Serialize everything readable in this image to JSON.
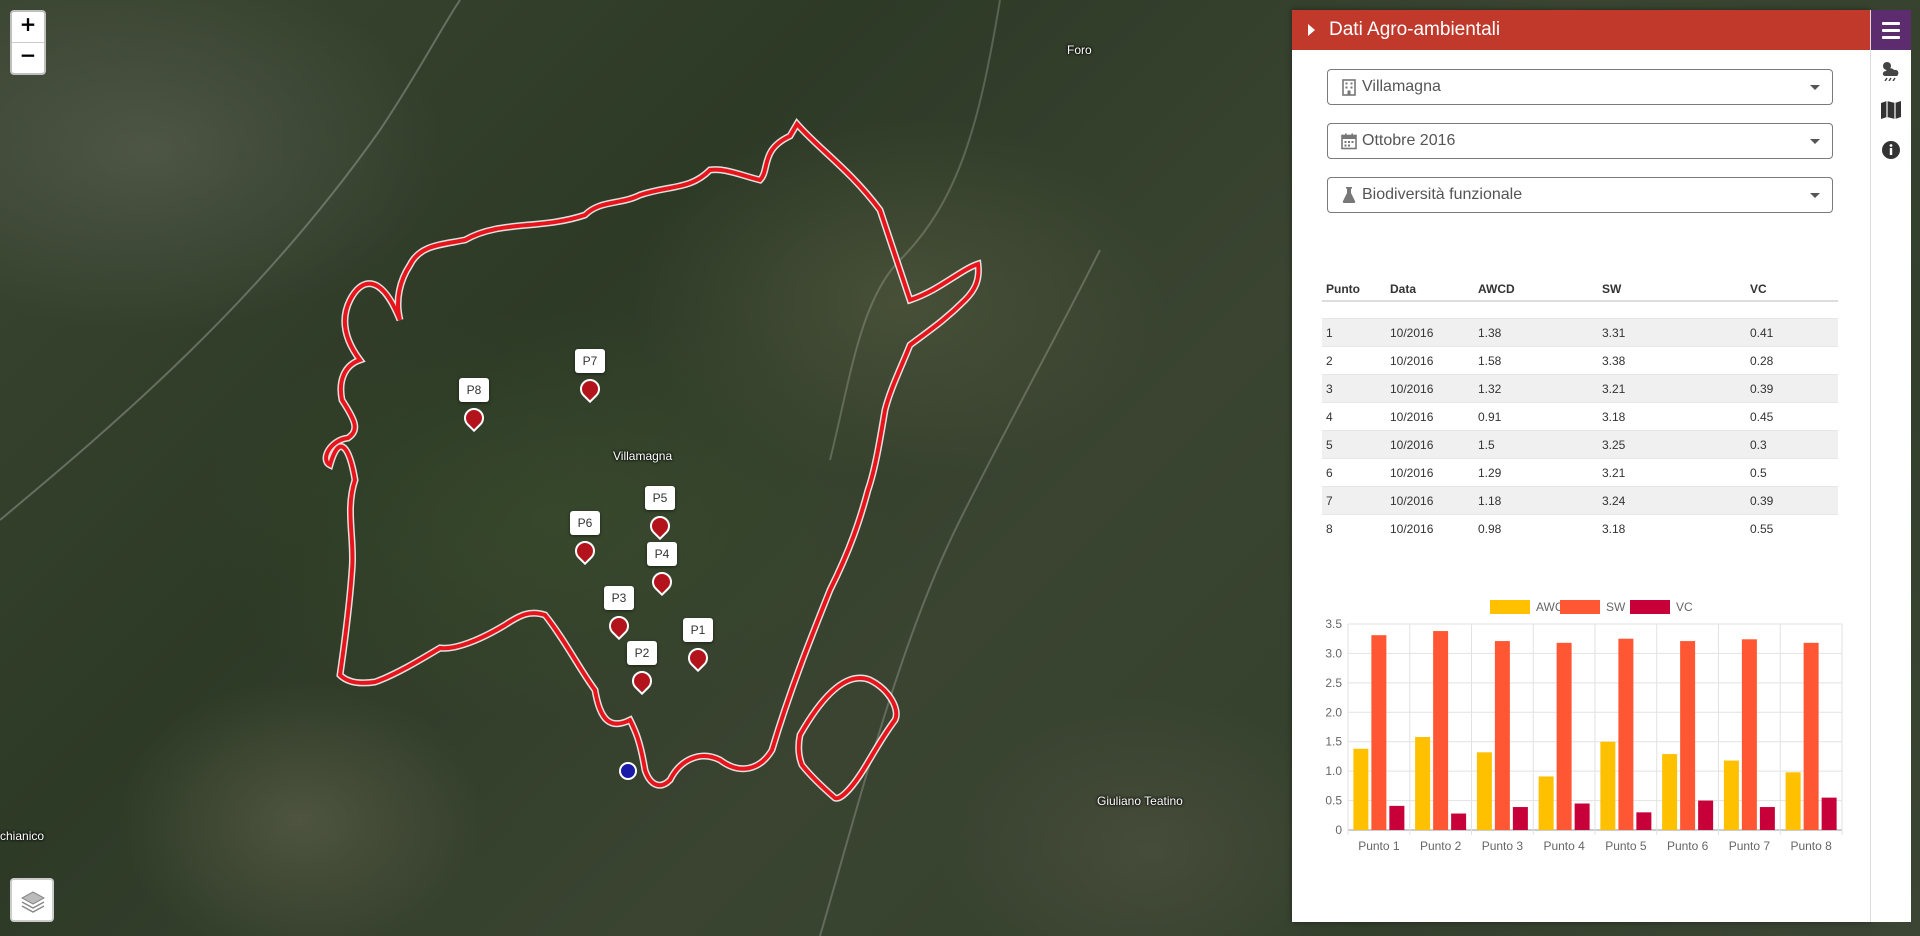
{
  "map": {
    "zoom_in": "+",
    "zoom_out": "−",
    "places": [
      {
        "name": "Villamagna"
      },
      {
        "name": "Foro"
      },
      {
        "name": "Giuliano Teatino"
      },
      {
        "name": "chianico"
      }
    ],
    "markers": [
      {
        "label": "P1"
      },
      {
        "label": "P2"
      },
      {
        "label": "P3"
      },
      {
        "label": "P4"
      },
      {
        "label": "P5"
      },
      {
        "label": "P6"
      },
      {
        "label": "P7"
      },
      {
        "label": "P8"
      }
    ],
    "boundary_color": "#e8141c",
    "marker_color": "#b3141c",
    "location_dot_color": "#1a1aa8"
  },
  "panel": {
    "title": "Dati Agro-ambientali",
    "header_color": "#c0392b",
    "selects": {
      "location": {
        "value": "Villamagna",
        "icon": "building-icon"
      },
      "period": {
        "value": "Ottobre 2016",
        "icon": "calendar-icon"
      },
      "indicator": {
        "value": "Biodiversità funzionale",
        "icon": "flask-icon"
      }
    },
    "table": {
      "headers": [
        "Punto",
        "Data",
        "AWCD",
        "SW",
        "VC"
      ],
      "rows": [
        [
          "1",
          "10/2016",
          "1.38",
          "3.31",
          "0.41"
        ],
        [
          "2",
          "10/2016",
          "1.58",
          "3.38",
          "0.28"
        ],
        [
          "3",
          "10/2016",
          "1.32",
          "3.21",
          "0.39"
        ],
        [
          "4",
          "10/2016",
          "0.91",
          "3.18",
          "0.45"
        ],
        [
          "5",
          "10/2016",
          "1.5",
          "3.25",
          "0.3"
        ],
        [
          "6",
          "10/2016",
          "1.29",
          "3.21",
          "0.5"
        ],
        [
          "7",
          "10/2016",
          "1.18",
          "3.24",
          "0.39"
        ],
        [
          "8",
          "10/2016",
          "0.98",
          "3.18",
          "0.55"
        ]
      ]
    }
  },
  "rail": {
    "menu_color": "#5c2c6e",
    "icons": [
      "menu-icon",
      "weather-icon",
      "map-icon",
      "info-icon"
    ]
  },
  "chart_data": {
    "type": "bar",
    "categories": [
      "Punto 1",
      "Punto 2",
      "Punto 3",
      "Punto 4",
      "Punto 5",
      "Punto 6",
      "Punto 7",
      "Punto 8"
    ],
    "series": [
      {
        "name": "AWCD",
        "color": "#ffc000",
        "values": [
          1.38,
          1.58,
          1.32,
          0.91,
          1.5,
          1.29,
          1.18,
          0.98
        ]
      },
      {
        "name": "SW",
        "color": "#ff5733",
        "values": [
          3.31,
          3.38,
          3.21,
          3.18,
          3.25,
          3.21,
          3.24,
          3.18
        ]
      },
      {
        "name": "VC",
        "color": "#c70039",
        "values": [
          0.41,
          0.28,
          0.39,
          0.45,
          0.3,
          0.5,
          0.39,
          0.55
        ]
      }
    ],
    "yticks": [
      "0",
      "0.5",
      "1.0",
      "1.5",
      "2.0",
      "2.5",
      "3.0",
      "3.5"
    ],
    "ylim": [
      0,
      3.5
    ],
    "grid": true,
    "legend": "top"
  }
}
